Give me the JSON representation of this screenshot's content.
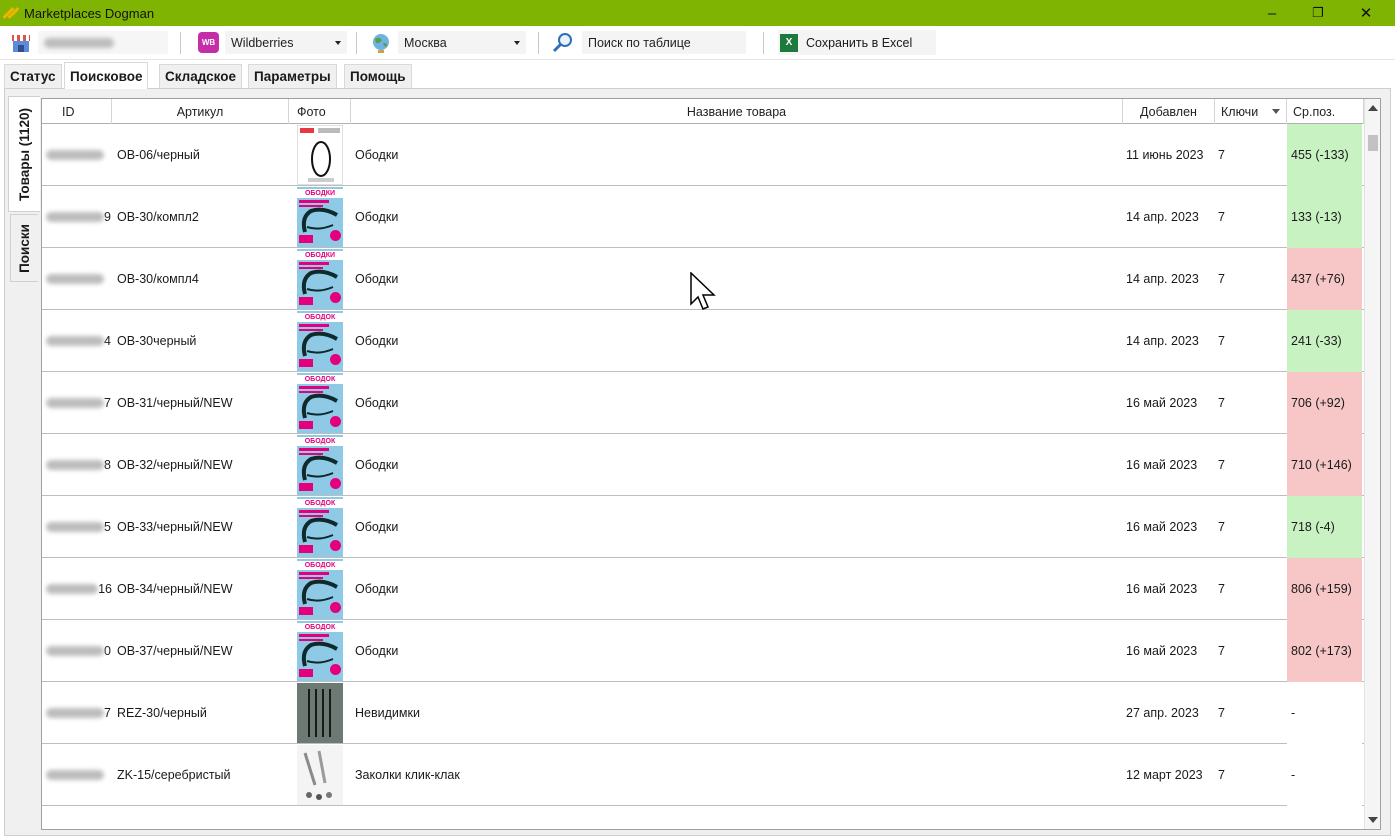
{
  "window": {
    "title": "Marketplaces Dogman",
    "minimize": "–",
    "restore": "❐",
    "close": "✕"
  },
  "toolbar": {
    "marketplace": "Wildberries",
    "marketplace_badge": "WB",
    "city": "Москва",
    "search_label": "Поиск по таблице",
    "excel_label": "Сохранить в Excel",
    "excel_badge": "X"
  },
  "tabs": [
    "Статус",
    "Поисковое",
    "Складское",
    "Параметры",
    "Помощь"
  ],
  "active_tab": "Поисковое",
  "side_tabs": {
    "products": "Товары (1120)",
    "searches": "Поиски"
  },
  "table": {
    "columns": [
      "ID",
      "Артикул",
      "Фото",
      "Название товара",
      "Добавлен",
      "Ключи",
      "Ср.поз."
    ],
    "rows": [
      {
        "id_tail": "",
        "article": "OB-06/черный",
        "name": "Ободки",
        "added": "11 июнь 2023",
        "keys": "7",
        "pos": "455 (-133)",
        "pos_color": "#c9f2c3",
        "photo": "white"
      },
      {
        "id_tail": "9",
        "article": "OB-30/компл2",
        "name": "Ободки",
        "added": "14 апр. 2023",
        "keys": "7",
        "pos": "133 (-13)",
        "pos_color": "#c9f2c3",
        "photo": "blue"
      },
      {
        "id_tail": "",
        "article": "OB-30/компл4",
        "name": "Ободки",
        "added": "14 апр. 2023",
        "keys": "7",
        "pos": "437 (+76)",
        "pos_color": "#f7c7c7",
        "photo": "blue"
      },
      {
        "id_tail": "4",
        "article": "OB-30черный",
        "name": "Ободки",
        "added": "14 апр. 2023",
        "keys": "7",
        "pos": "241 (-33)",
        "pos_color": "#c9f2c3",
        "photo": "blue"
      },
      {
        "id_tail": "7",
        "article": "OB-31/черный/NEW",
        "name": "Ободки",
        "added": "16 май 2023",
        "keys": "7",
        "pos": "706 (+92)",
        "pos_color": "#f7c7c7",
        "photo": "blue"
      },
      {
        "id_tail": "8",
        "article": "OB-32/черный/NEW",
        "name": "Ободки",
        "added": "16 май 2023",
        "keys": "7",
        "pos": "710 (+146)",
        "pos_color": "#f7c7c7",
        "photo": "blue"
      },
      {
        "id_tail": "5",
        "article": "OB-33/черный/NEW",
        "name": "Ободки",
        "added": "16 май 2023",
        "keys": "7",
        "pos": "718 (-4)",
        "pos_color": "#c9f2c3",
        "photo": "blue"
      },
      {
        "id_tail": "16",
        "article": "OB-34/черный/NEW",
        "name": "Ободки",
        "added": "16 май 2023",
        "keys": "7",
        "pos": "806 (+159)",
        "pos_color": "#f7c7c7",
        "photo": "blue"
      },
      {
        "id_tail": "0",
        "article": "OB-37/черный/NEW",
        "name": "Ободки",
        "added": "16 май 2023",
        "keys": "7",
        "pos": "802 (+173)",
        "pos_color": "#f7c7c7",
        "photo": "blue"
      },
      {
        "id_tail": "7",
        "article": "REZ-30/черный",
        "name": "Невидимки",
        "added": "27 апр. 2023",
        "keys": "7",
        "pos": "-",
        "pos_color": "#ffffff",
        "photo": "grey"
      },
      {
        "id_tail": "",
        "article": "ZK-15/серебристый",
        "name": "Заколки клик-клак",
        "added": "12 март 2023",
        "keys": "7",
        "pos": "-",
        "pos_color": "#ffffff",
        "photo": "light"
      }
    ],
    "photo_band_text": [
      "",
      "ОБОДКИ",
      "ОБОДКИ",
      "ОБОДОК",
      "ОБОДОК",
      "ОБОДОК",
      "ОБОДОК",
      "ОБОДОК",
      "ОБОДОК",
      "",
      ""
    ]
  },
  "colors": {
    "titlebar": "#7fb502",
    "pos_good": "#c9f2c3",
    "pos_bad": "#f7c7c7"
  }
}
